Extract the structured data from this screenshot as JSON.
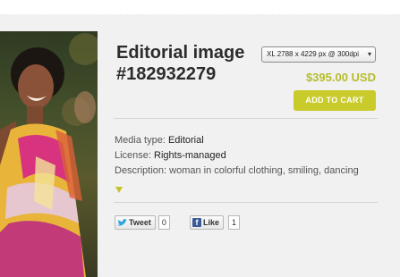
{
  "product": {
    "title_line1": "Editorial image",
    "title_line2": "#182932279",
    "size_option": "XL 2788 x 4229 px @ 300dpi",
    "price": "$395.00 USD",
    "add_to_cart_label": "ADD TO CART"
  },
  "details": {
    "media_type_label": "Media type:",
    "media_type_value": "Editorial",
    "license_label": "License:",
    "license_value": "Rights-managed",
    "description_label": "Description:",
    "description_value": "woman in colorful clothing, smiling, dancing"
  },
  "social": {
    "tweet_label": "Tweet",
    "tweet_count": "0",
    "like_label": "Like",
    "like_count": "1"
  },
  "colors": {
    "accent": "#c9cb2b",
    "price": "#b5bd2a",
    "panel_bg": "#f1f1f1"
  }
}
